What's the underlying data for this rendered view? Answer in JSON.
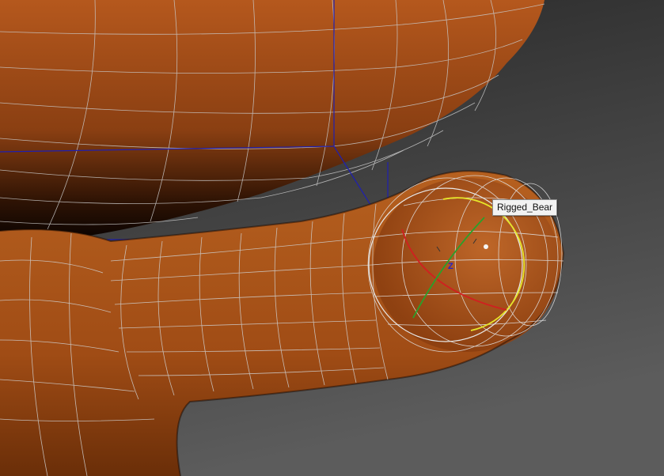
{
  "viewport": {
    "background_top": "#2e2e2e",
    "background_bottom": "#5a5a5a",
    "mesh_color": "#a8521c",
    "wire_color": "#c8c8c8",
    "bounding_box_color": "#1a1aa8"
  },
  "tooltip": {
    "text": "Rigged_Bear"
  },
  "gizmo": {
    "axis_label": "Z",
    "ring_colors": {
      "view": "#dddddd",
      "screen": "#e6e62a",
      "x": "#d02020",
      "y": "#2aa02a",
      "z": "#2222cc"
    }
  }
}
